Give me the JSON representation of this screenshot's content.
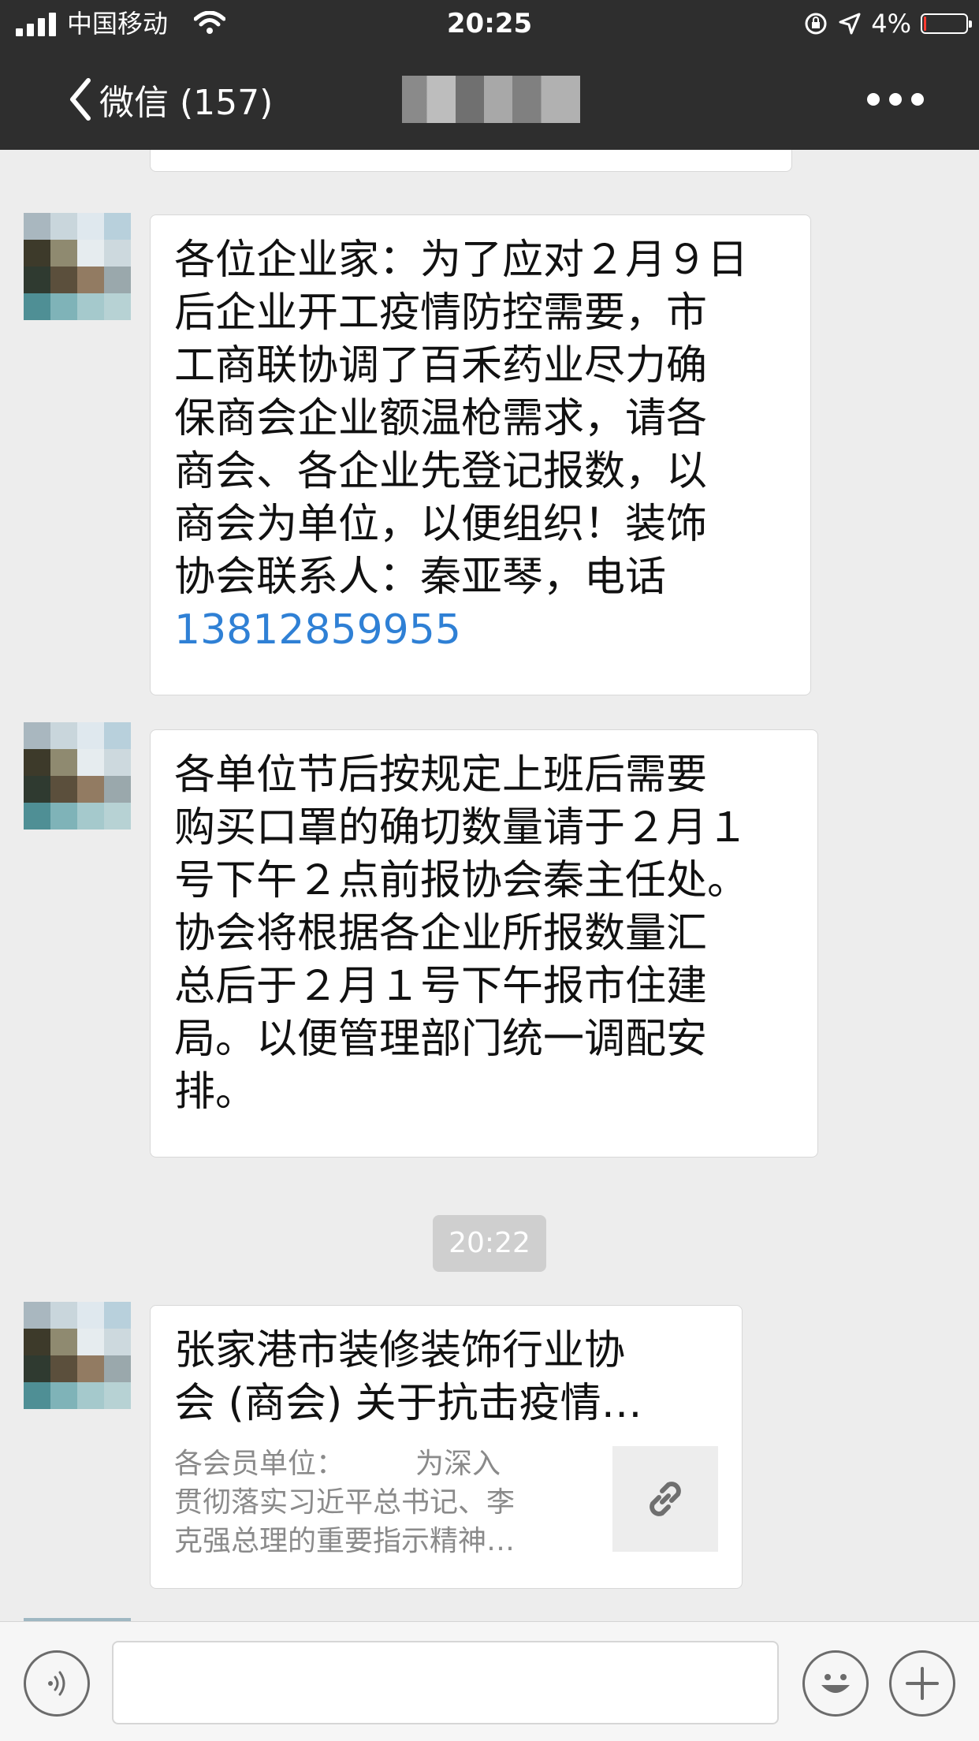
{
  "status_bar": {
    "carrier": "中国移动",
    "time": "20:25",
    "battery": "4%",
    "battery_level": 0.04
  },
  "nav": {
    "back_label": "微信 (157)"
  },
  "messages": [
    {
      "text": "各位企业家：为了应对２月９日\n后企业开工疫情防控需要，市\n工商联协调了百禾药业尽力确\n保商会企业额温枪需求，请各\n商会、各企业先登记报数，以\n商会为单位，以便组织！装饰\n协会联系人：秦亚琴，电话",
      "phone": "13812859955"
    },
    {
      "text": "各单位节后按规定上班后需要\n购买口罩的确切数量请于２月１\n号下午２点前报协会秦主任处。\n协会将根据各企业所报数量汇\n总后于２月１号下午报市住建\n局。以便管理部门统一调配安\n排。"
    }
  ],
  "timestamp": "20:22",
  "link_card": {
    "title_line1": "张家港市装修装饰行业协",
    "title_line2": "会 (商会) 关于抗击疫情…",
    "description": "各会员单位：　　　为深入\n贯彻落实习近平总书记、李\n克强总理的重要指示精神…"
  },
  "icons": {
    "back": "chevron-left-icon",
    "more": "more-dots-icon",
    "link": "link-icon",
    "voice": "voice-icon",
    "emoji": "emoji-icon",
    "add": "plus-icon"
  },
  "input": {
    "value": ""
  }
}
